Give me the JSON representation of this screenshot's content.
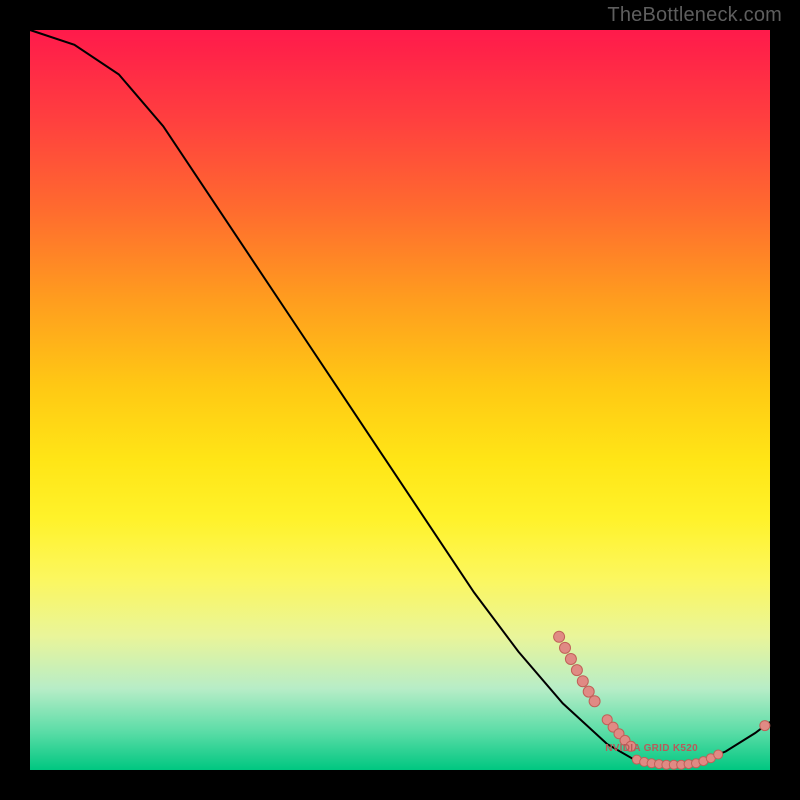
{
  "attribution": "TheBottleneck.com",
  "colors": {
    "curve": "#000000",
    "marker_fill": "#e08a84",
    "marker_stroke": "#c06058",
    "label_fill": "#b85a5a"
  },
  "chart_data": {
    "type": "line",
    "title": "",
    "xlabel": "",
    "ylabel": "",
    "xlim": [
      0,
      100
    ],
    "ylim": [
      0,
      100
    ],
    "curve": [
      {
        "x": 0,
        "y": 100
      },
      {
        "x": 6,
        "y": 98
      },
      {
        "x": 12,
        "y": 94
      },
      {
        "x": 18,
        "y": 87
      },
      {
        "x": 24,
        "y": 78
      },
      {
        "x": 30,
        "y": 69
      },
      {
        "x": 36,
        "y": 60
      },
      {
        "x": 42,
        "y": 51
      },
      {
        "x": 48,
        "y": 42
      },
      {
        "x": 54,
        "y": 33
      },
      {
        "x": 60,
        "y": 24
      },
      {
        "x": 66,
        "y": 16
      },
      {
        "x": 72,
        "y": 9
      },
      {
        "x": 78,
        "y": 3.5
      },
      {
        "x": 82,
        "y": 1.2
      },
      {
        "x": 86,
        "y": 0.6
      },
      {
        "x": 90,
        "y": 1.0
      },
      {
        "x": 94,
        "y": 2.5
      },
      {
        "x": 98,
        "y": 5.0
      },
      {
        "x": 100,
        "y": 6.5
      }
    ],
    "markers_cluster_upper": [
      {
        "x": 71.5,
        "y": 18.0
      },
      {
        "x": 72.3,
        "y": 16.5
      },
      {
        "x": 73.1,
        "y": 15.0
      },
      {
        "x": 73.9,
        "y": 13.5
      },
      {
        "x": 74.7,
        "y": 12.0
      },
      {
        "x": 75.5,
        "y": 10.6
      },
      {
        "x": 76.3,
        "y": 9.3
      }
    ],
    "markers_cluster_diag": [
      {
        "x": 78.0,
        "y": 6.8
      },
      {
        "x": 78.8,
        "y": 5.8
      },
      {
        "x": 79.6,
        "y": 4.9
      },
      {
        "x": 80.4,
        "y": 4.0
      },
      {
        "x": 81.2,
        "y": 3.2
      }
    ],
    "markers_cluster_bottom": [
      {
        "x": 82.0,
        "y": 1.4
      },
      {
        "x": 83.0,
        "y": 1.1
      },
      {
        "x": 84.0,
        "y": 0.9
      },
      {
        "x": 85.0,
        "y": 0.8
      },
      {
        "x": 86.0,
        "y": 0.7
      },
      {
        "x": 87.0,
        "y": 0.7
      },
      {
        "x": 88.0,
        "y": 0.7
      },
      {
        "x": 89.0,
        "y": 0.8
      },
      {
        "x": 90.0,
        "y": 0.9
      },
      {
        "x": 91.0,
        "y": 1.2
      },
      {
        "x": 92.0,
        "y": 1.6
      },
      {
        "x": 93.0,
        "y": 2.1
      }
    ],
    "markers_extra": [
      {
        "x": 99.3,
        "y": 6.0
      }
    ],
    "inline_label": {
      "text": "NVIDIA GRID K520",
      "x": 84.0,
      "y": 2.6
    }
  }
}
